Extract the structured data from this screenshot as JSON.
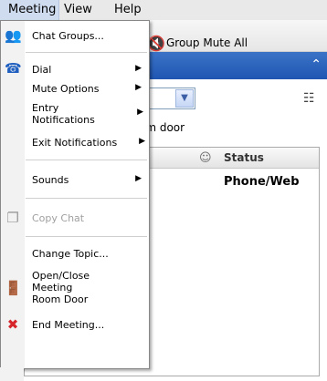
{
  "menubar": {
    "items": [
      "Meeting",
      "View",
      "Help"
    ]
  },
  "toolbar": {
    "group_mute_label": "Group Mute All"
  },
  "panel": {
    "door_partial": "om door"
  },
  "table": {
    "status_header": "Status",
    "row1_status": "Phone/Web"
  },
  "menu": {
    "chat_groups": "Chat Groups...",
    "dial": "Dial",
    "mute_options": "Mute Options",
    "entry_notifications": "Entry Notifications",
    "exit_notifications": "Exit Notifications",
    "sounds": "Sounds",
    "copy_chat": "Copy Chat",
    "change_topic": "Change Topic...",
    "open_close_door": "Open/Close Meeting Room Door",
    "end_meeting": "End Meeting..."
  },
  "icons": {
    "chat_groups": "people-group-icon",
    "dial": "phone-icon",
    "copy_chat": "copy-icon",
    "door": "door-icon",
    "end_meeting": "red-x-icon",
    "group_mute": "mute-speaker-icon"
  }
}
